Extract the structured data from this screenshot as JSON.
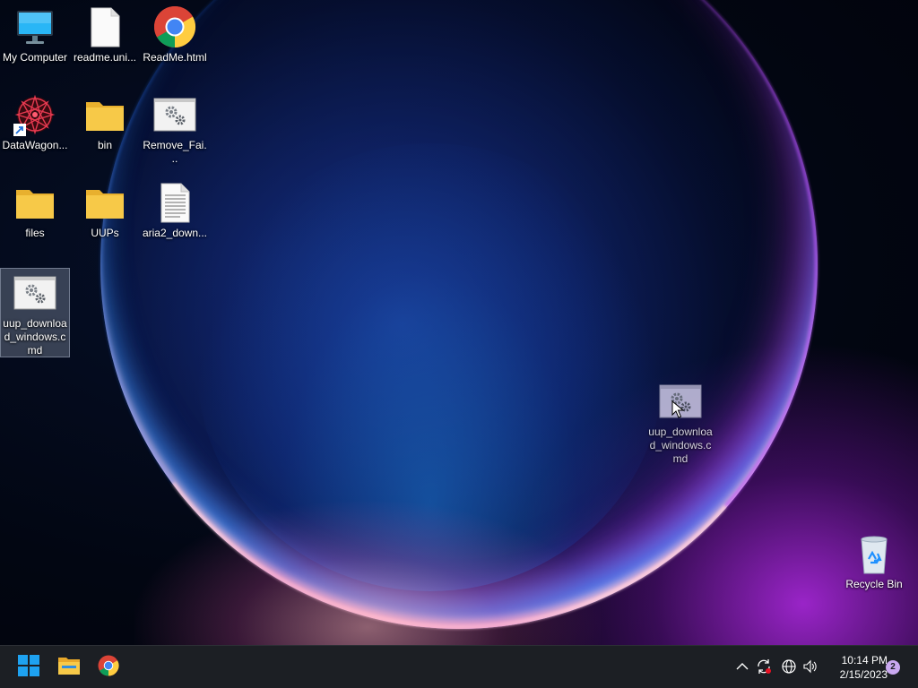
{
  "desktop": {
    "icons": [
      {
        "label": "My Computer",
        "icon": "monitor-icon"
      },
      {
        "label": "readme.uni...",
        "icon": "blank-file-icon"
      },
      {
        "label": "ReadMe.html",
        "icon": "chrome-icon"
      },
      {
        "label": "DataWagon...",
        "icon": "datawagon-shortcut-icon"
      },
      {
        "label": "bin",
        "icon": "folder-icon"
      },
      {
        "label": "Remove_Fai...",
        "icon": "gear-script-icon"
      },
      {
        "label": "files",
        "icon": "folder-icon"
      },
      {
        "label": "UUPs",
        "icon": "folder-icon"
      },
      {
        "label": "aria2_down...",
        "icon": "text-file-icon"
      },
      {
        "label": "uup_download_windows.cmd",
        "icon": "gear-script-icon",
        "selected": true
      },
      {
        "label": "uup_download_windows.cmd",
        "icon": "gear-script-icon",
        "dragging": true
      },
      {
        "label": "Recycle Bin",
        "icon": "recycle-bin-icon"
      }
    ]
  },
  "taskbar": {
    "pinned": [
      {
        "name": "Start",
        "icon": "windows-start-icon"
      },
      {
        "name": "File Explorer",
        "icon": "file-explorer-icon"
      },
      {
        "name": "Google Chrome",
        "icon": "chrome-icon"
      }
    ],
    "tray": {
      "icons": [
        "chevron-up-icon",
        "sync-icon",
        "globe-icon",
        "speaker-icon"
      ],
      "time": "10:14 PM",
      "date": "2/15/2023",
      "notification_count": "2"
    }
  },
  "colors": {
    "taskbar_bg": "#1c1f24",
    "accent_blue": "#1e90ff",
    "folder_yellow": "#f7c948",
    "badge": "#c9a8f0"
  }
}
